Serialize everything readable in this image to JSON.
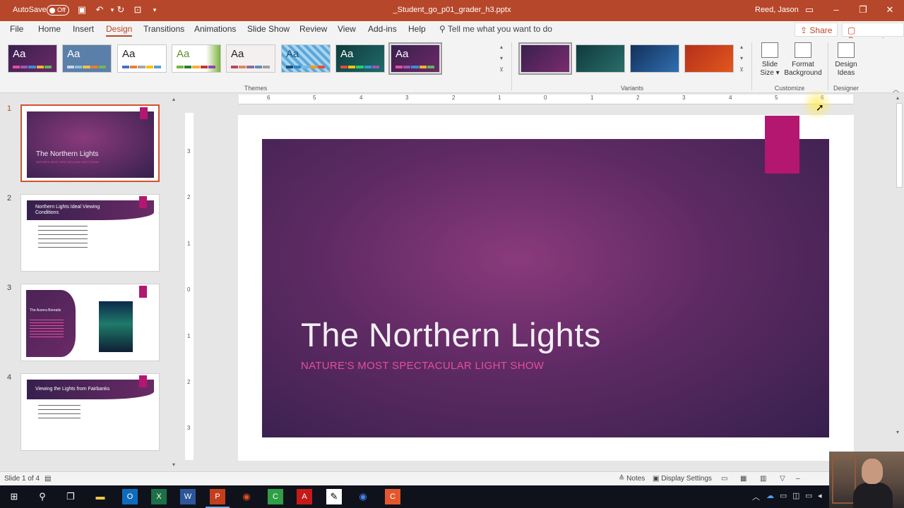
{
  "titlebar": {
    "autosave_label": "AutoSave",
    "autosave_state": "Off",
    "document_title": "_Student_go_p01_grader_h3.pptx",
    "user": "Reed, Jason"
  },
  "menu": {
    "tabs": [
      "File",
      "Home",
      "Insert",
      "Design",
      "Transitions",
      "Animations",
      "Slide Show",
      "Review",
      "View",
      "Add-ins",
      "Help"
    ],
    "active_tab": "Design",
    "tell_me": "Tell me what you want to do",
    "share": "Share",
    "comments": "Comments"
  },
  "ribbon": {
    "themes_label": "Themes",
    "variants_label": "Variants",
    "customize_label": "Customize",
    "designer_label": "Designer",
    "slide_size_line1": "Slide",
    "slide_size_line2": "Size",
    "format_bg_line1": "Format",
    "format_bg_line2": "Background",
    "design_ideas_line1": "Design",
    "design_ideas_line2": "Ideas",
    "theme_sample_text": "Aa"
  },
  "thumbnails": [
    {
      "num": "1",
      "title": "The Northern Lights",
      "subtitle": "NATURE'S MOST SPECTACULAR LIGHT SHOW"
    },
    {
      "num": "2",
      "title": "Northern Lights Ideal Viewing Conditions"
    },
    {
      "num": "3",
      "title": "The Aurora Borealis"
    },
    {
      "num": "4",
      "title": "Viewing the Lights from Fairbanks"
    }
  ],
  "slide": {
    "title": "The Northern Lights",
    "subtitle": "NATURE'S MOST SPECTACULAR LIGHT SHOW"
  },
  "ruler": {
    "h_ticks": [
      "6",
      "5",
      "4",
      "3",
      "2",
      "1",
      "0",
      "1",
      "2",
      "3",
      "4",
      "5",
      "6"
    ],
    "v_ticks": [
      "3",
      "2",
      "1",
      "0",
      "1",
      "2",
      "3"
    ]
  },
  "status": {
    "slide_count": "Slide 1 of 4",
    "notes": "Notes",
    "display_settings": "Display Settings"
  },
  "colors": {
    "accent": "#b7472a",
    "slide_pink": "#b3176f",
    "subtitle_pink": "#e44e9d"
  }
}
